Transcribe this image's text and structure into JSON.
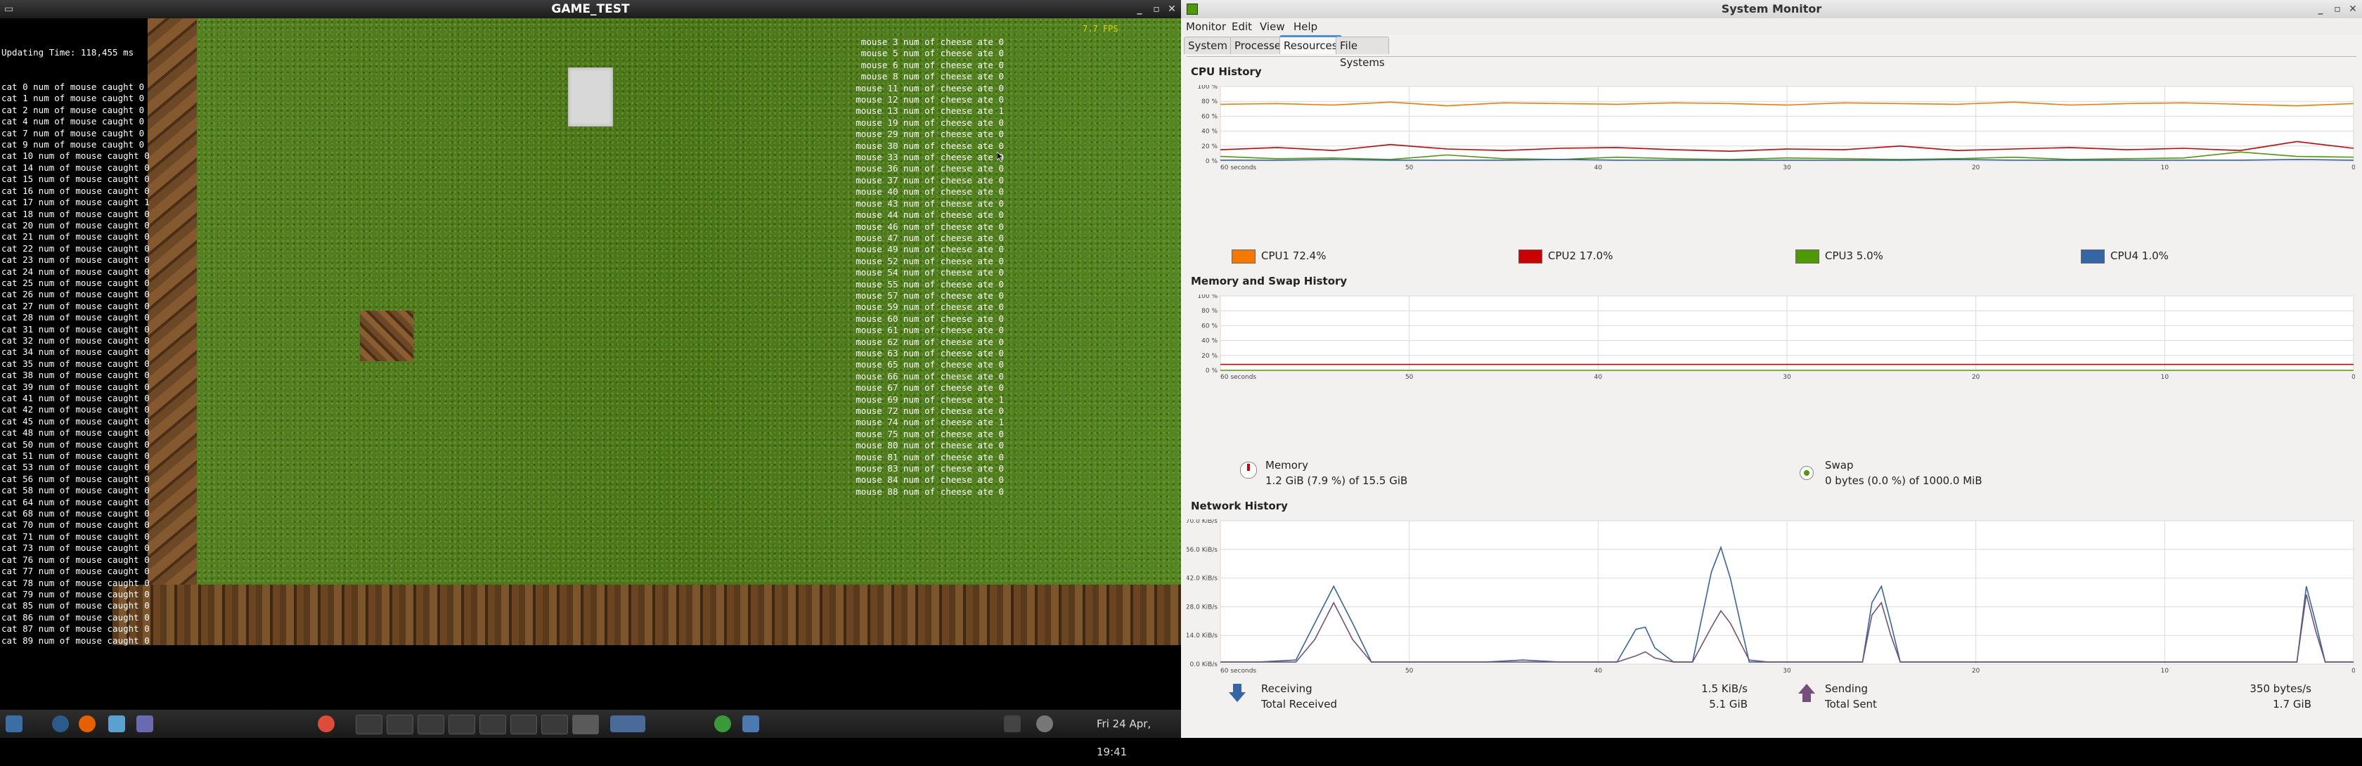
{
  "game": {
    "title": "GAME_TEST",
    "fps": "7.7 FPS",
    "updating_time": "Updating Time: 118,455 ms",
    "cat_log": [
      "cat 0 num of mouse caught 0",
      "cat 1 num of mouse caught 0",
      "cat 2 num of mouse caught 0",
      "cat 4 num of mouse caught 0",
      "cat 7 num of mouse caught 0",
      "cat 9 num of mouse caught 0",
      "cat 10 num of mouse caught 0",
      "cat 14 num of mouse caught 0",
      "cat 15 num of mouse caught 0",
      "cat 16 num of mouse caught 0",
      "cat 17 num of mouse caught 1",
      "cat 18 num of mouse caught 0",
      "cat 20 num of mouse caught 0",
      "cat 21 num of mouse caught 0",
      "cat 22 num of mouse caught 0",
      "cat 23 num of mouse caught 0",
      "cat 24 num of mouse caught 0",
      "cat 25 num of mouse caught 0",
      "cat 26 num of mouse caught 0",
      "cat 27 num of mouse caught 0",
      "cat 28 num of mouse caught 0",
      "cat 31 num of mouse caught 0",
      "cat 32 num of mouse caught 0",
      "cat 34 num of mouse caught 0",
      "cat 35 num of mouse caught 0",
      "cat 38 num of mouse caught 0",
      "cat 39 num of mouse caught 0",
      "cat 41 num of mouse caught 0",
      "cat 42 num of mouse caught 0",
      "cat 45 num of mouse caught 0",
      "cat 48 num of mouse caught 0",
      "cat 50 num of mouse caught 0",
      "cat 51 num of mouse caught 0",
      "cat 53 num of mouse caught 0",
      "cat 56 num of mouse caught 0",
      "cat 58 num of mouse caught 0",
      "cat 64 num of mouse caught 0",
      "cat 68 num of mouse caught 0",
      "cat 70 num of mouse caught 0",
      "cat 71 num of mouse caught 0",
      "cat 73 num of mouse caught 0",
      "cat 76 num of mouse caught 0",
      "cat 77 num of mouse caught 0",
      "cat 78 num of mouse caught 0",
      "cat 79 num of mouse caught 0",
      "cat 85 num of mouse caught 0",
      "cat 86 num of mouse caught 0",
      "cat 87 num of mouse caught 0",
      "cat 89 num of mouse caught 0"
    ],
    "mouse_log": [
      "mouse 3 num of cheese ate 0",
      "mouse 5 num of cheese ate 0",
      "mouse 6 num of cheese ate 0",
      "mouse 8 num of cheese ate 0",
      "mouse 11 num of cheese ate 0",
      "mouse 12 num of cheese ate 0",
      "mouse 13 num of cheese ate 1",
      "mouse 19 num of cheese ate 0",
      "mouse 29 num of cheese ate 0",
      "mouse 30 num of cheese ate 0",
      "mouse 33 num of cheese ate 0",
      "mouse 36 num of cheese ate 0",
      "mouse 37 num of cheese ate 0",
      "mouse 40 num of cheese ate 0",
      "mouse 43 num of cheese ate 0",
      "mouse 44 num of cheese ate 0",
      "mouse 46 num of cheese ate 0",
      "mouse 47 num of cheese ate 0",
      "mouse 49 num of cheese ate 0",
      "mouse 52 num of cheese ate 0",
      "mouse 54 num of cheese ate 0",
      "mouse 55 num of cheese ate 0",
      "mouse 57 num of cheese ate 0",
      "mouse 59 num of cheese ate 0",
      "mouse 60 num of cheese ate 0",
      "mouse 61 num of cheese ate 0",
      "mouse 62 num of cheese ate 0",
      "mouse 63 num of cheese ate 0",
      "mouse 65 num of cheese ate 0",
      "mouse 66 num of cheese ate 0",
      "mouse 67 num of cheese ate 0",
      "mouse 69 num of cheese ate 1",
      "mouse 72 num of cheese ate 0",
      "mouse 74 num of cheese ate 1",
      "mouse 75 num of cheese ate 0",
      "mouse 80 num of cheese ate 0",
      "mouse 81 num of cheese ate 0",
      "mouse 83 num of cheese ate 0",
      "mouse 84 num of cheese ate 0",
      "mouse 88 num of cheese ate 0"
    ]
  },
  "taskbar": {
    "clock": "Fri 24 Apr, 19:41"
  },
  "sysmon": {
    "title": "System Monitor",
    "menu": [
      "Monitor",
      "Edit",
      "View",
      "Help"
    ],
    "tabs": [
      "System",
      "Processes",
      "Resources",
      "File Systems"
    ],
    "active_tab": "Resources",
    "cpu": {
      "title": "CPU History",
      "legend": [
        {
          "label": "CPU1",
          "value": "72.4%",
          "color": "#f57900"
        },
        {
          "label": "CPU2",
          "value": "17.0%",
          "color": "#cc0000"
        },
        {
          "label": "CPU3",
          "value": "5.0%",
          "color": "#4e9a06"
        },
        {
          "label": "CPU4",
          "value": "1.0%",
          "color": "#3465a4"
        }
      ]
    },
    "memory": {
      "title": "Memory and Swap History",
      "memory_label": "Memory",
      "memory_value": "1.2 GiB (7.9 %) of 15.5 GiB",
      "swap_label": "Swap",
      "swap_value": "0 bytes (0.0 %) of 1000.0 MiB",
      "memory_color": "#cc0000",
      "swap_color": "#4e9a06"
    },
    "network": {
      "title": "Network History",
      "receiving_label": "Receiving",
      "receiving_value": "1.5 KiB/s",
      "total_received_label": "Total Received",
      "total_received_value": "5.1 GiB",
      "sending_label": "Sending",
      "sending_value": "350 bytes/s",
      "total_sent_label": "Total Sent",
      "total_sent_value": "1.7 GiB",
      "receiving_color": "#3465a4",
      "sending_color": "#75507b"
    },
    "axis": {
      "x_ticks": [
        "60 seconds",
        "50",
        "40",
        "30",
        "20",
        "10",
        "0"
      ],
      "percent_ticks": [
        "100 %",
        "80 %",
        "60 %",
        "40 %",
        "20 %",
        "0 %"
      ],
      "net_ticks": [
        "70.0 KiB/s",
        "56.0 KiB/s",
        "42.0 KiB/s",
        "28.0 KiB/s",
        "14.0 KiB/s",
        "0.0 KiB/s"
      ]
    }
  },
  "chart_data": [
    {
      "type": "line",
      "title": "CPU History",
      "x": [
        60,
        57,
        54,
        51,
        48,
        45,
        42,
        39,
        36,
        33,
        30,
        27,
        24,
        21,
        18,
        15,
        12,
        9,
        6,
        3,
        0
      ],
      "ylim": [
        0,
        100
      ],
      "series": [
        {
          "name": "CPU1",
          "values": [
            76,
            77,
            75,
            79,
            74,
            78,
            77,
            76,
            78,
            77,
            75,
            78,
            77,
            76,
            79,
            75,
            77,
            78,
            76,
            74,
            77
          ]
        },
        {
          "name": "CPU2",
          "values": [
            15,
            18,
            14,
            22,
            16,
            14,
            17,
            18,
            15,
            13,
            16,
            15,
            20,
            14,
            16,
            18,
            15,
            17,
            14,
            26,
            17
          ]
        },
        {
          "name": "CPU3",
          "values": [
            6,
            3,
            4,
            2,
            8,
            3,
            2,
            5,
            3,
            2,
            4,
            3,
            2,
            3,
            5,
            2,
            3,
            4,
            12,
            6,
            5
          ]
        },
        {
          "name": "CPU4",
          "values": [
            1,
            1,
            2,
            1,
            1,
            1,
            2,
            1,
            1,
            1,
            1,
            1,
            1,
            2,
            1,
            1,
            1,
            1,
            1,
            2,
            1
          ]
        }
      ]
    },
    {
      "type": "line",
      "title": "Memory and Swap History",
      "x": [
        60,
        0
      ],
      "ylim": [
        0,
        100
      ],
      "series": [
        {
          "name": "Memory",
          "values": [
            7.9,
            7.9
          ]
        },
        {
          "name": "Swap",
          "values": [
            0.0,
            0.0
          ]
        }
      ]
    },
    {
      "type": "line",
      "title": "Network History",
      "x": [
        60,
        58,
        56,
        55,
        54,
        53,
        52,
        50,
        48,
        46,
        44,
        42,
        40,
        39,
        38,
        37.5,
        37,
        36,
        35,
        34,
        33.5,
        33,
        32,
        31,
        30,
        29,
        28,
        26,
        25.5,
        25,
        24.5,
        24,
        23,
        22,
        20,
        18,
        16,
        14,
        12,
        10,
        8,
        6,
        4,
        3,
        2.5,
        2,
        1.5,
        1,
        0
      ],
      "ylim": [
        0,
        70
      ],
      "series": [
        {
          "name": "Receiving",
          "values": [
            1,
            1,
            2,
            20,
            38,
            20,
            1,
            1,
            1,
            1,
            2,
            1,
            1,
            1,
            17,
            18,
            8,
            1,
            1,
            45,
            57,
            42,
            1,
            1,
            1,
            1,
            1,
            1,
            30,
            38,
            20,
            1,
            1,
            1,
            1,
            1,
            1,
            1,
            1,
            1,
            1,
            1,
            1,
            1,
            38,
            20,
            1,
            1,
            1
          ]
        },
        {
          "name": "Sending",
          "values": [
            1,
            1,
            1,
            12,
            30,
            12,
            1,
            1,
            1,
            1,
            1,
            1,
            1,
            1,
            4,
            6,
            3,
            1,
            1,
            18,
            26,
            20,
            2,
            1,
            1,
            1,
            1,
            1,
            24,
            30,
            14,
            1,
            1,
            1,
            1,
            1,
            1,
            1,
            1,
            1,
            1,
            1,
            1,
            1,
            34,
            16,
            1,
            1,
            1
          ]
        }
      ]
    }
  ]
}
